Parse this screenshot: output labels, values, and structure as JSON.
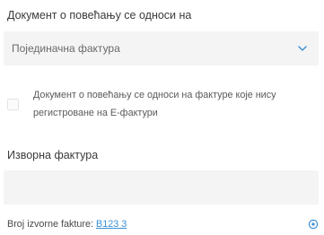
{
  "document_relates": {
    "label": "Документ о повећању се односи на",
    "select_value": "Појединачна фактура",
    "dropdown_icon": "chevron-down-icon"
  },
  "not_registered": {
    "checked": false,
    "text": "Документ о повећању се односи на фактуре које нису регистроване на Е-фактури"
  },
  "source_invoice": {
    "label": "Изворна фактура",
    "value": "",
    "placeholder": ""
  },
  "reference": {
    "label": "Broj izvorne fakture:",
    "link": "B123 3",
    "icon": "circle-dot-icon"
  },
  "colors": {
    "accent": "#3a8fd6",
    "field_bg": "#f4f4f5"
  }
}
